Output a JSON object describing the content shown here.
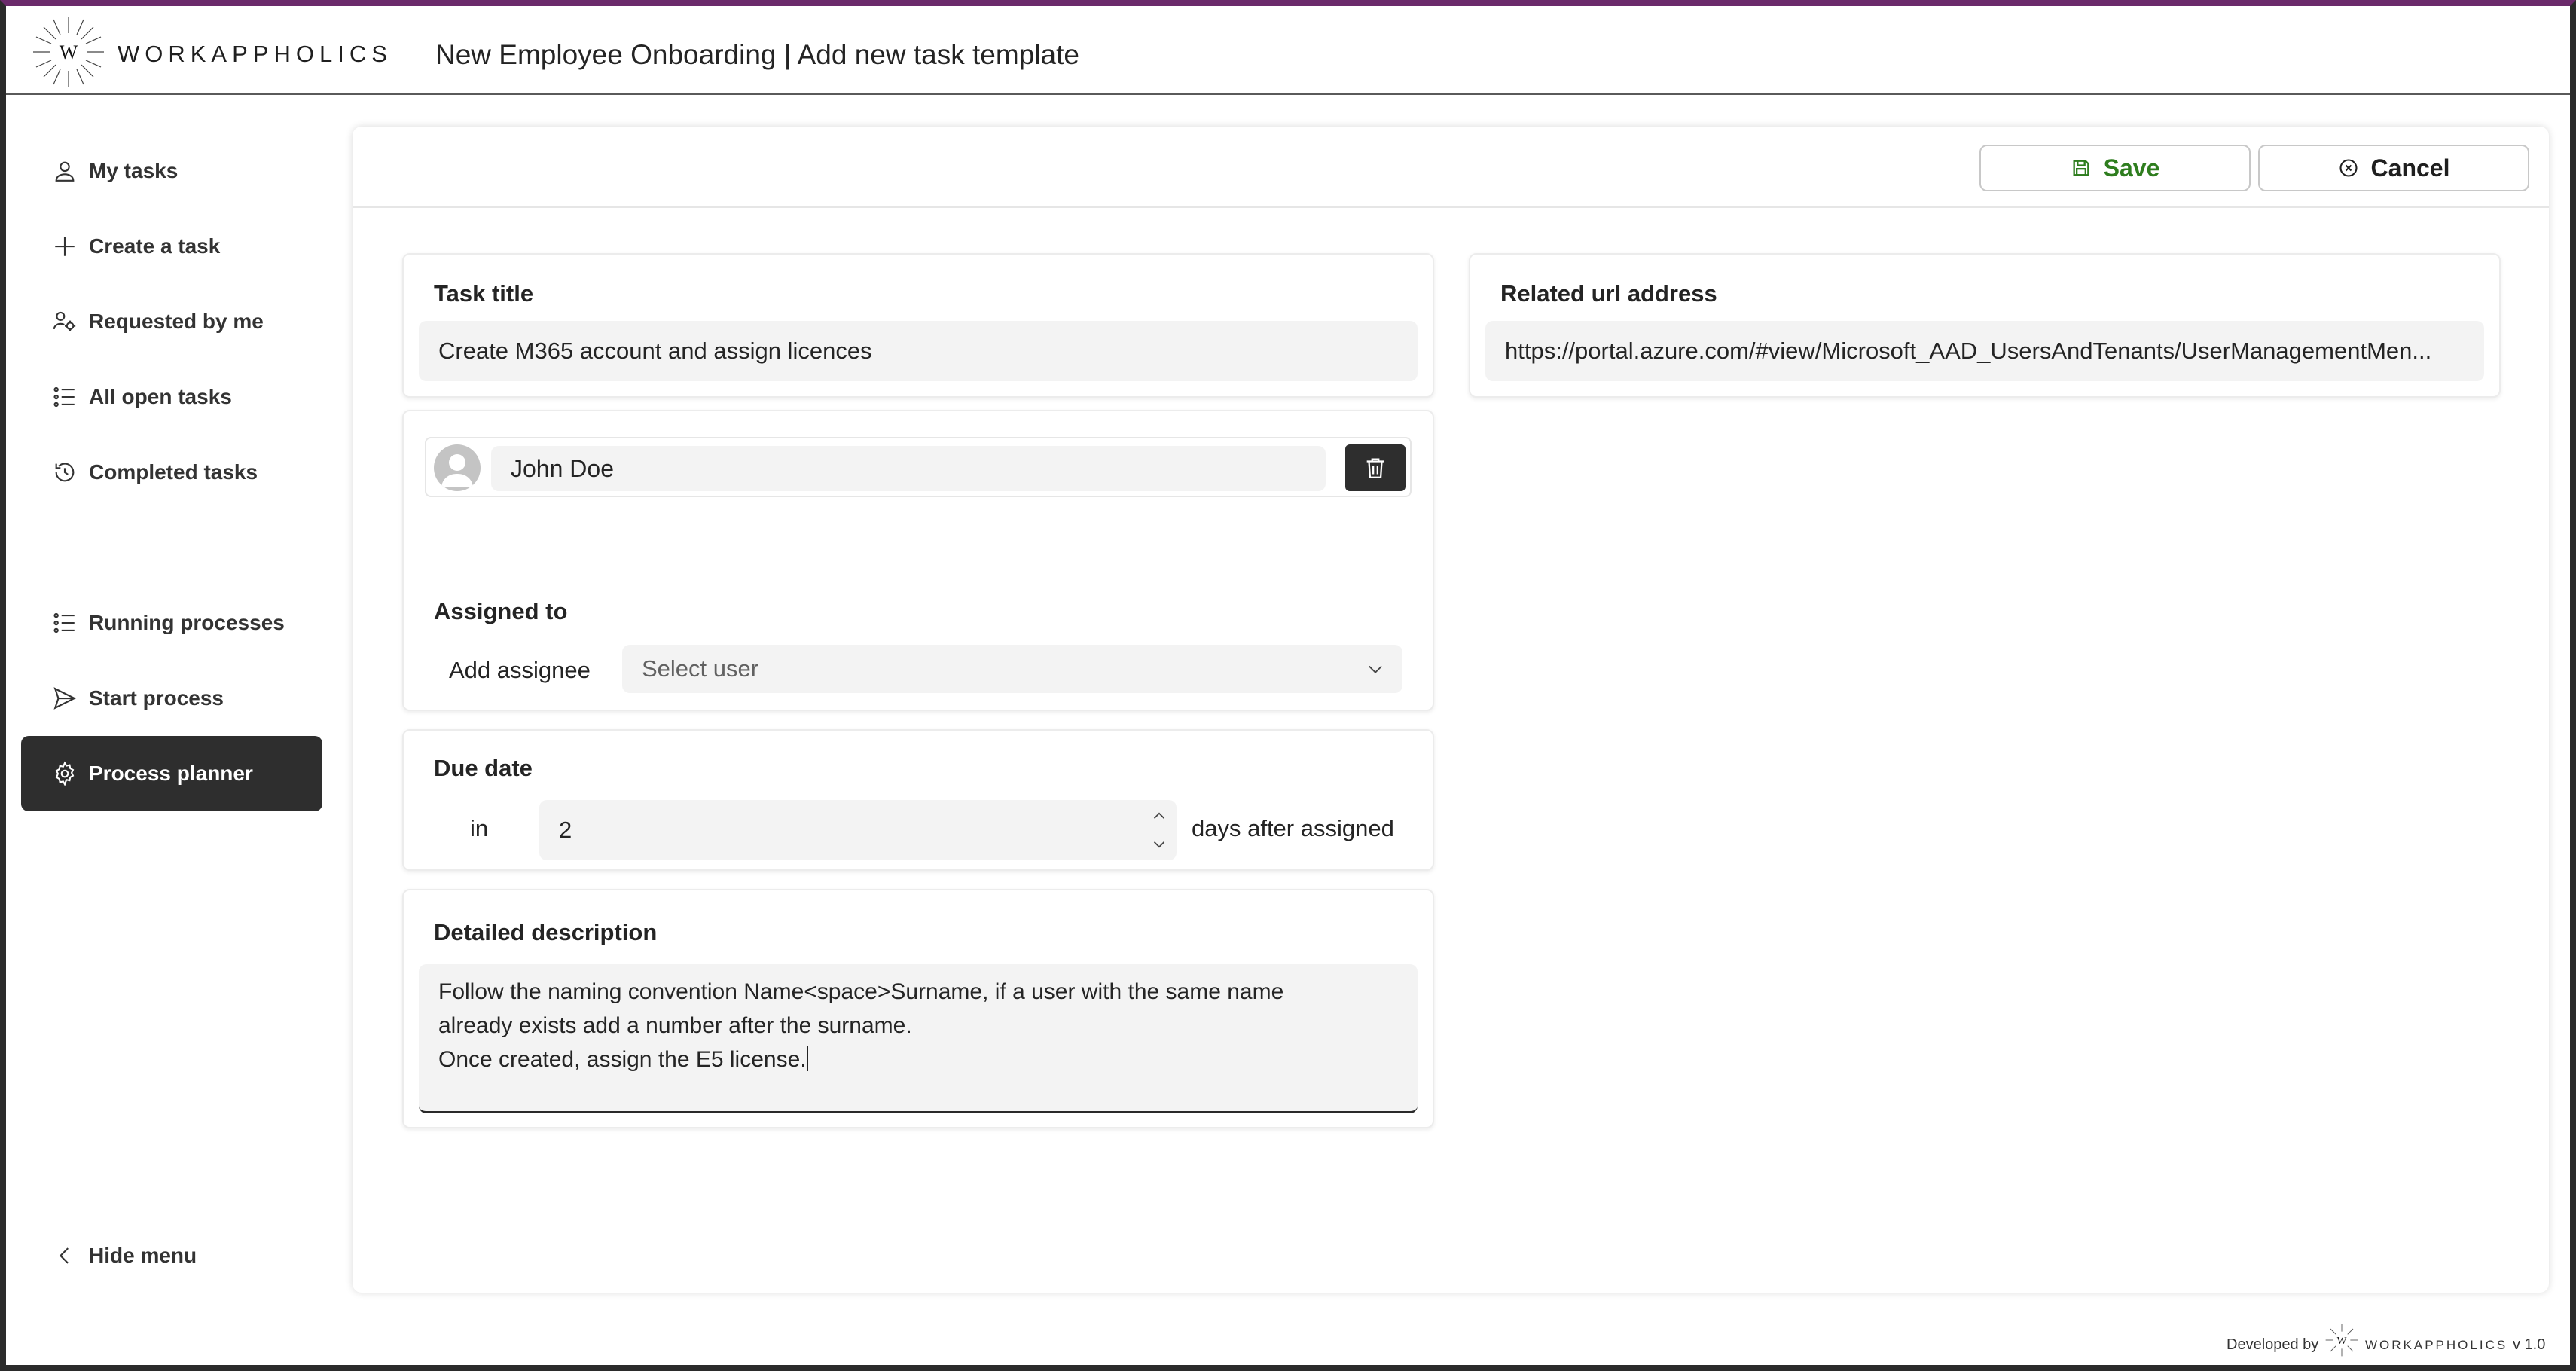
{
  "header": {
    "brand": "WORKAPPHOLICS",
    "title": "New Employee Onboarding | Add new task template"
  },
  "sidebar": {
    "items": [
      {
        "label": "My tasks",
        "icon": "person-icon"
      },
      {
        "label": "Create a task",
        "icon": "plus-icon"
      },
      {
        "label": "Requested by me",
        "icon": "people-settings-icon"
      },
      {
        "label": "All open tasks",
        "icon": "list-icon"
      },
      {
        "label": "Completed tasks",
        "icon": "history-icon"
      },
      {
        "label": "Running processes",
        "icon": "list-icon"
      },
      {
        "label": "Start process",
        "icon": "send-icon"
      },
      {
        "label": "Process planner",
        "icon": "gear-icon"
      }
    ],
    "hide_menu": "Hide menu"
  },
  "toolbar": {
    "save_label": "Save",
    "cancel_label": "Cancel"
  },
  "form": {
    "task_title_label": "Task title",
    "task_title_value": "Create M365 account and assign licences",
    "url_label": "Related url address",
    "url_value": "https://portal.azure.com/#view/Microsoft_AAD_UsersAndTenants/UserManagementMen...",
    "assignee_name": "John Doe",
    "assigned_to_label": "Assigned to",
    "add_assignee_label": "Add assignee",
    "select_user_placeholder": "Select user",
    "due_date_label": "Due date",
    "due_in_label": "in",
    "due_days_value": "2",
    "due_suffix": "days after assigned",
    "description_label": "Detailed description",
    "description_value": "Follow the naming convention Name<space>Surname, if a user with the same name\nalready exists add a number after the surname.\nOnce created, assign the E5 license."
  },
  "footer": {
    "developed_by": "Developed by",
    "brand": "WORKAPPHOLICS",
    "version": "v 1.0"
  },
  "colors": {
    "accent_top": "#6b2a6b",
    "active_nav": "#2e2e2e",
    "save_green": "#2e7d1e"
  }
}
